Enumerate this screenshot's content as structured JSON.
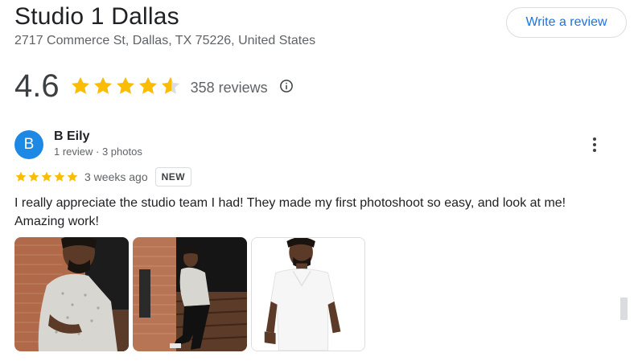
{
  "place": {
    "title": "Studio 1 Dallas",
    "address": "2717 Commerce St, Dallas, TX 75226, United States",
    "write_review_label": "Write a review"
  },
  "rating": {
    "value": "4.6",
    "stars_filled": 4.6,
    "reviews_label": "358 reviews"
  },
  "review": {
    "avatar_letter": "B",
    "reviewer_name": "B Eily",
    "reviewer_meta": "1 review · 3 photos",
    "stars": 5,
    "date": "3 weeks ago",
    "badge": "NEW",
    "text": "I really appreciate the studio team I had! They made my first photoshoot so easy, and look at me! Amazing work!"
  },
  "colors": {
    "star": "#fbbc04",
    "star_empty": "#dadce0",
    "accent": "#1a73e8",
    "avatar_bg": "#1e88e5"
  },
  "icons": {
    "info": "info-icon",
    "more": "more-vertical-icon",
    "star": "star-icon"
  }
}
